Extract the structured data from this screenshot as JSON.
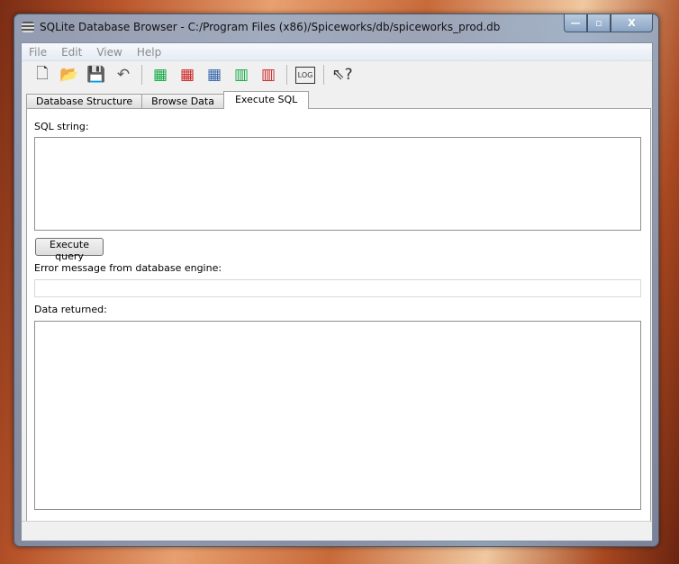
{
  "window": {
    "title": "SQLite Database Browser - C:/Program Files (x86)/Spiceworks/db/spiceworks_prod.db",
    "minimize": "—",
    "maximize": "▫",
    "close": "X"
  },
  "menu": [
    "File",
    "Edit",
    "View",
    "Help"
  ],
  "toolbar": [
    {
      "name": "new-database-icon",
      "glyph": "🗋"
    },
    {
      "name": "open-database-icon",
      "glyph": "📂"
    },
    {
      "name": "save-icon",
      "glyph": "💾"
    },
    {
      "name": "undo-icon",
      "glyph": "↶"
    },
    {
      "name": "create-table-icon",
      "glyph": "▦"
    },
    {
      "name": "delete-table-icon",
      "glyph": "▦"
    },
    {
      "name": "modify-table-icon",
      "glyph": "▦"
    },
    {
      "name": "create-index-icon",
      "glyph": "▥"
    },
    {
      "name": "delete-index-icon",
      "glyph": "▥"
    },
    {
      "name": "log-icon",
      "glyph": "LOG"
    },
    {
      "name": "whats-this-icon",
      "glyph": "⇖?"
    }
  ],
  "tabs": [
    "Database Structure",
    "Browse Data",
    "Execute SQL"
  ],
  "execute": {
    "sql_label": "SQL string:",
    "sql_value": "",
    "button": "Execute query",
    "error_label": "Error message from database engine:",
    "error_value": "",
    "data_label": "Data returned:"
  }
}
